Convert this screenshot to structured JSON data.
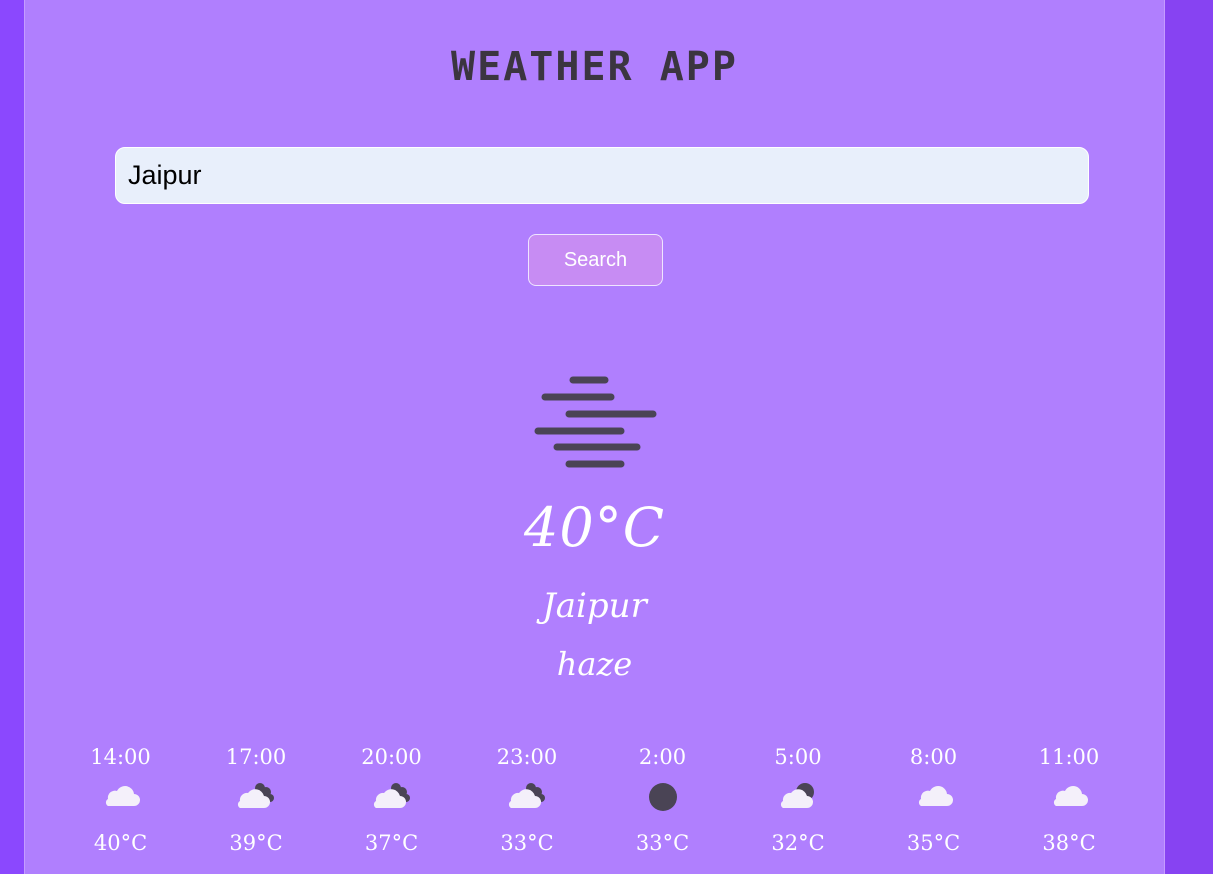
{
  "app": {
    "title": "WEATHER APP",
    "colors": {
      "page_background": "#8b48fe",
      "panel_background": "#b07ffe",
      "input_background": "#e8effb",
      "button_background": "#c78cf3",
      "icon_dark": "#4a4455"
    }
  },
  "search": {
    "value": "Jaipur",
    "button_label": "Search"
  },
  "current": {
    "icon": "haze-icon",
    "temperature": "40°C",
    "city": "Jaipur",
    "condition": "haze"
  },
  "forecast": [
    {
      "time": "14:00",
      "icon": "cloud-icon",
      "temp": "40°C"
    },
    {
      "time": "17:00",
      "icon": "cloud-night-icon",
      "temp": "39°C"
    },
    {
      "time": "20:00",
      "icon": "cloud-night-icon",
      "temp": "37°C"
    },
    {
      "time": "23:00",
      "icon": "cloud-night-icon",
      "temp": "33°C"
    },
    {
      "time": "2:00",
      "icon": "moon-icon",
      "temp": "33°C"
    },
    {
      "time": "5:00",
      "icon": "cloud-moon-icon",
      "temp": "32°C"
    },
    {
      "time": "8:00",
      "icon": "cloud-icon",
      "temp": "35°C"
    },
    {
      "time": "11:00",
      "icon": "cloud-icon",
      "temp": "38°C"
    }
  ]
}
